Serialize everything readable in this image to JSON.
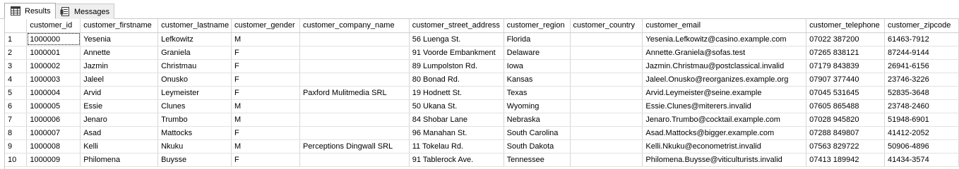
{
  "tabs": [
    {
      "label": "Results",
      "icon": "grid-icon",
      "active": true
    },
    {
      "label": "Messages",
      "icon": "messages-icon",
      "active": false
    }
  ],
  "grid": {
    "columns": [
      "customer_id",
      "customer_firstname",
      "customer_lastname",
      "customer_gender",
      "customer_company_name",
      "customer_street_address",
      "customer_region",
      "customer_country",
      "customer_email",
      "customer_telephone",
      "customer_zipcode"
    ],
    "rows": [
      {
        "n": "1",
        "cells": [
          "1000000",
          "Yesenia",
          "Lefkowitz",
          "M",
          "",
          "56 Luenga St.",
          "Florida",
          "",
          "Yesenia.Lefkowitz@casino.example.com",
          "07022 387200",
          "61463-7912"
        ]
      },
      {
        "n": "2",
        "cells": [
          "1000001",
          "Annette",
          "Graniela",
          "F",
          "",
          "91 Voorde Embankment",
          "Delaware",
          "",
          "Annette.Graniela@sofas.test",
          "07265 838121",
          "87244-9144"
        ]
      },
      {
        "n": "3",
        "cells": [
          "1000002",
          "Jazmin",
          "Christmau",
          "F",
          "",
          "89 Lumpolston Rd.",
          "Iowa",
          "",
          "Jazmin.Christmau@postclassical.invalid",
          "07179 843839",
          "26941-6156"
        ]
      },
      {
        "n": "4",
        "cells": [
          "1000003",
          "Jaleel",
          "Onusko",
          "F",
          "",
          "80 Bonad Rd.",
          "Kansas",
          "",
          "Jaleel.Onusko@reorganizes.example.org",
          "07907 377440",
          "23746-3226"
        ]
      },
      {
        "n": "5",
        "cells": [
          "1000004",
          "Arvid",
          "Leymeister",
          "F",
          "Paxford Mulitmedia SRL",
          "19 Hodnett St.",
          "Texas",
          "",
          "Arvid.Leymeister@seine.example",
          "07045 531645",
          "52835-3648"
        ]
      },
      {
        "n": "6",
        "cells": [
          "1000005",
          "Essie",
          "Clunes",
          "M",
          "",
          "50 Ukana St.",
          "Wyoming",
          "",
          "Essie.Clunes@miterers.invalid",
          "07605 865488",
          "23748-2460"
        ]
      },
      {
        "n": "7",
        "cells": [
          "1000006",
          "Jenaro",
          "Trumbo",
          "M",
          "",
          "84 Shobar Lane",
          "Nebraska",
          "",
          "Jenaro.Trumbo@cocktail.example.com",
          "07028 945820",
          "51948-6901"
        ]
      },
      {
        "n": "8",
        "cells": [
          "1000007",
          "Asad",
          "Mattocks",
          "F",
          "",
          "96 Manahan St.",
          "South Carolina",
          "",
          "Asad.Mattocks@bigger.example.com",
          "07288 849807",
          "41412-2052"
        ]
      },
      {
        "n": "9",
        "cells": [
          "1000008",
          "Kelli",
          "Nkuku",
          "M",
          "Perceptions Dingwall SRL",
          "11 Tokelau Rd.",
          "South Dakota",
          "",
          "Kelli.Nkuku@econometrist.invalid",
          "07563 829722",
          "50906-4896"
        ]
      },
      {
        "n": "10",
        "cells": [
          "1000009",
          "Philomena",
          "Buysse",
          "F",
          "",
          "91 Tablerock Ave.",
          "Tennessee",
          "",
          "Philomena.Buysse@viticulturists.invalid",
          "07413 189942",
          "41434-3574"
        ]
      }
    ]
  }
}
